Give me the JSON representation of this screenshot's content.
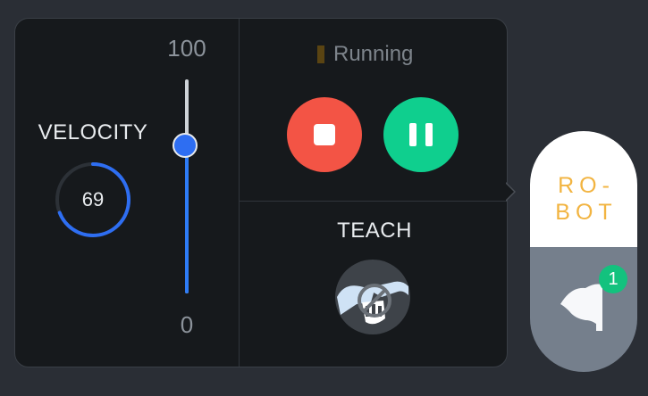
{
  "velocity": {
    "label": "VELOCITY",
    "value": "69",
    "fraction": 0.69,
    "ring_color": "#2e6ef2"
  },
  "slider": {
    "max_label": "100",
    "min_label": "0",
    "value": 69,
    "max": 100,
    "min": 0,
    "accent": "#2e7cf6"
  },
  "status": {
    "text": "Running",
    "indicator_color": "#5a4412"
  },
  "controls": {
    "stop_icon": "stop-icon",
    "pause_icon": "pause-icon",
    "stop_color": "#f35445",
    "pause_color": "#0fcf8e"
  },
  "teach": {
    "label": "TEACH",
    "icon": "robot-hand-disabled-icon"
  },
  "robot": {
    "label": "RO-\nBOT",
    "label_color": "#f2b441",
    "flag_icon": "flag-icon",
    "badge": "1",
    "badge_color": "#13c27e"
  }
}
